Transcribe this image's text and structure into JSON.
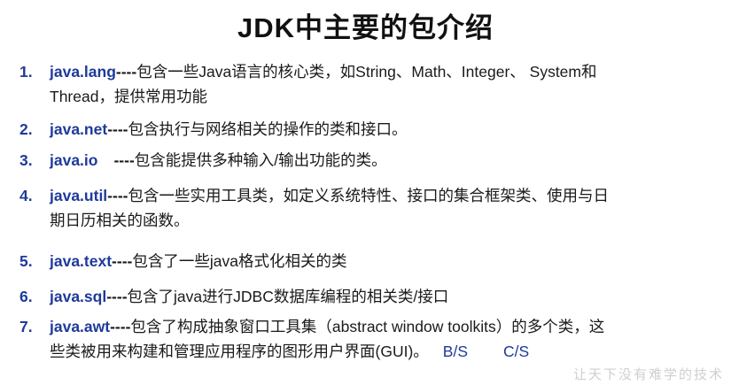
{
  "title": "JDK中主要的包介绍",
  "items": [
    {
      "number": "1.",
      "package": "java.lang",
      "sep": "----",
      "line1": "包含一些Java语言的核心类，如String、Math、Integer、 System和",
      "line2": "Thread，提供常用功能"
    },
    {
      "number": "2.",
      "package": "java.net",
      "sep": "----",
      "line1": "包含执行与网络相关的操作的类和接口。"
    },
    {
      "number": "3.",
      "package": "java.io",
      "sep": "----",
      "line1": "包含能提供多种输入/输出功能的类。"
    },
    {
      "number": "4.",
      "package": "java.util",
      "sep": "----",
      "line1": "包含一些实用工具类，如定义系统特性、接口的集合框架类、使用与日",
      "line2": "期日历相关的函数。"
    },
    {
      "number": "5.",
      "package": "java.text",
      "sep": "----",
      "line1": "包含了一些java格式化相关的类"
    },
    {
      "number": "6.",
      "package": "java.sql",
      "sep": "----",
      "line1": "包含了java进行JDBC数据库编程的相关类/接口"
    },
    {
      "number": "7.",
      "package": "java.awt",
      "sep": "----",
      "line1": "包含了构成抽象窗口工具集（abstract window toolkits）的多个类，这",
      "line2": "些类被用来构建和管理应用程序的图形用户界面(GUI)。",
      "tag_bs": "B/S",
      "tag_cs": "C/S"
    }
  ],
  "watermark": "让天下没有难学的技术",
  "colors": {
    "package_blue": "#1e3a9a",
    "text": "#1a1a1a"
  }
}
